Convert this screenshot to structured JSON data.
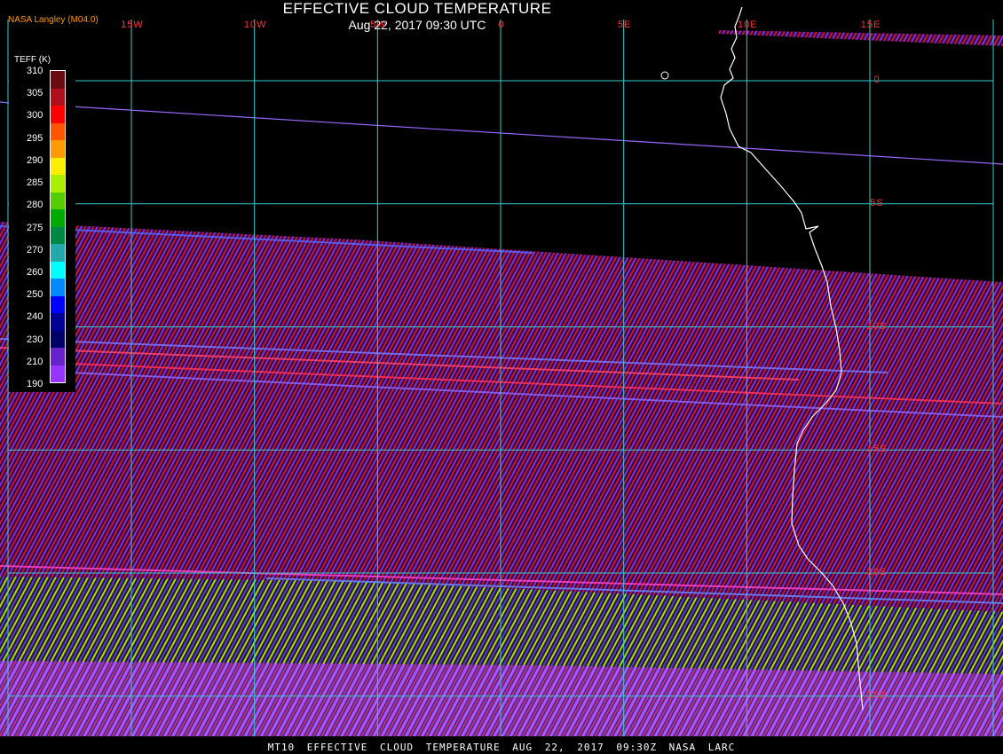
{
  "header": {
    "title": "EFFECTIVE CLOUD TEMPERATURE",
    "datetime": "Aug 22, 2017 09:30 UTC",
    "credit": "NASA Langley (M04.0)"
  },
  "footer": {
    "text": "MT10  EFFECTIVE CLOUD TEMPERATURE  AUG 22, 2017 09:30Z  NASA LARC"
  },
  "legend": {
    "title": "TEFF (K)",
    "ticks": [
      "310",
      "305",
      "300",
      "295",
      "290",
      "285",
      "280",
      "275",
      "270",
      "260",
      "250",
      "240",
      "230",
      "210",
      "190"
    ],
    "colors": [
      "#6b0c12",
      "#b0101c",
      "#ff0000",
      "#ff5500",
      "#ff9a00",
      "#ffee00",
      "#aaee00",
      "#55cc00",
      "#00aa00",
      "#008844",
      "#22aaaa",
      "#00ffff",
      "#0088ff",
      "#0000ff",
      "#000099",
      "#000066",
      "#6622cc",
      "#9933ff"
    ]
  },
  "grid": {
    "longitudes": [
      {
        "label": "15W",
        "lon": -15
      },
      {
        "label": "10W",
        "lon": -10
      },
      {
        "label": "5W",
        "lon": -5
      },
      {
        "label": "0",
        "lon": 0
      },
      {
        "label": "5E",
        "lon": 5
      },
      {
        "label": "10E",
        "lon": 10
      },
      {
        "label": "15E",
        "lon": 15
      }
    ],
    "latitudes": [
      {
        "label": "0",
        "lat": 0
      },
      {
        "label": "5S",
        "lat": -5
      },
      {
        "label": "10S",
        "lat": -10
      },
      {
        "label": "15S",
        "lat": -15
      },
      {
        "label": "20S",
        "lat": -20
      },
      {
        "label": "25S",
        "lat": -25
      }
    ],
    "grid_color": "#33cccc",
    "label_color": "#ff3030"
  },
  "map": {
    "lon_range": [
      -20,
      20
    ],
    "lat_range": [
      2.5,
      -26
    ],
    "coastline_color": "#ffffff",
    "cloud_colors": [
      "#9933ff",
      "#ff0044",
      "#ccee00",
      "#5555ff"
    ]
  }
}
